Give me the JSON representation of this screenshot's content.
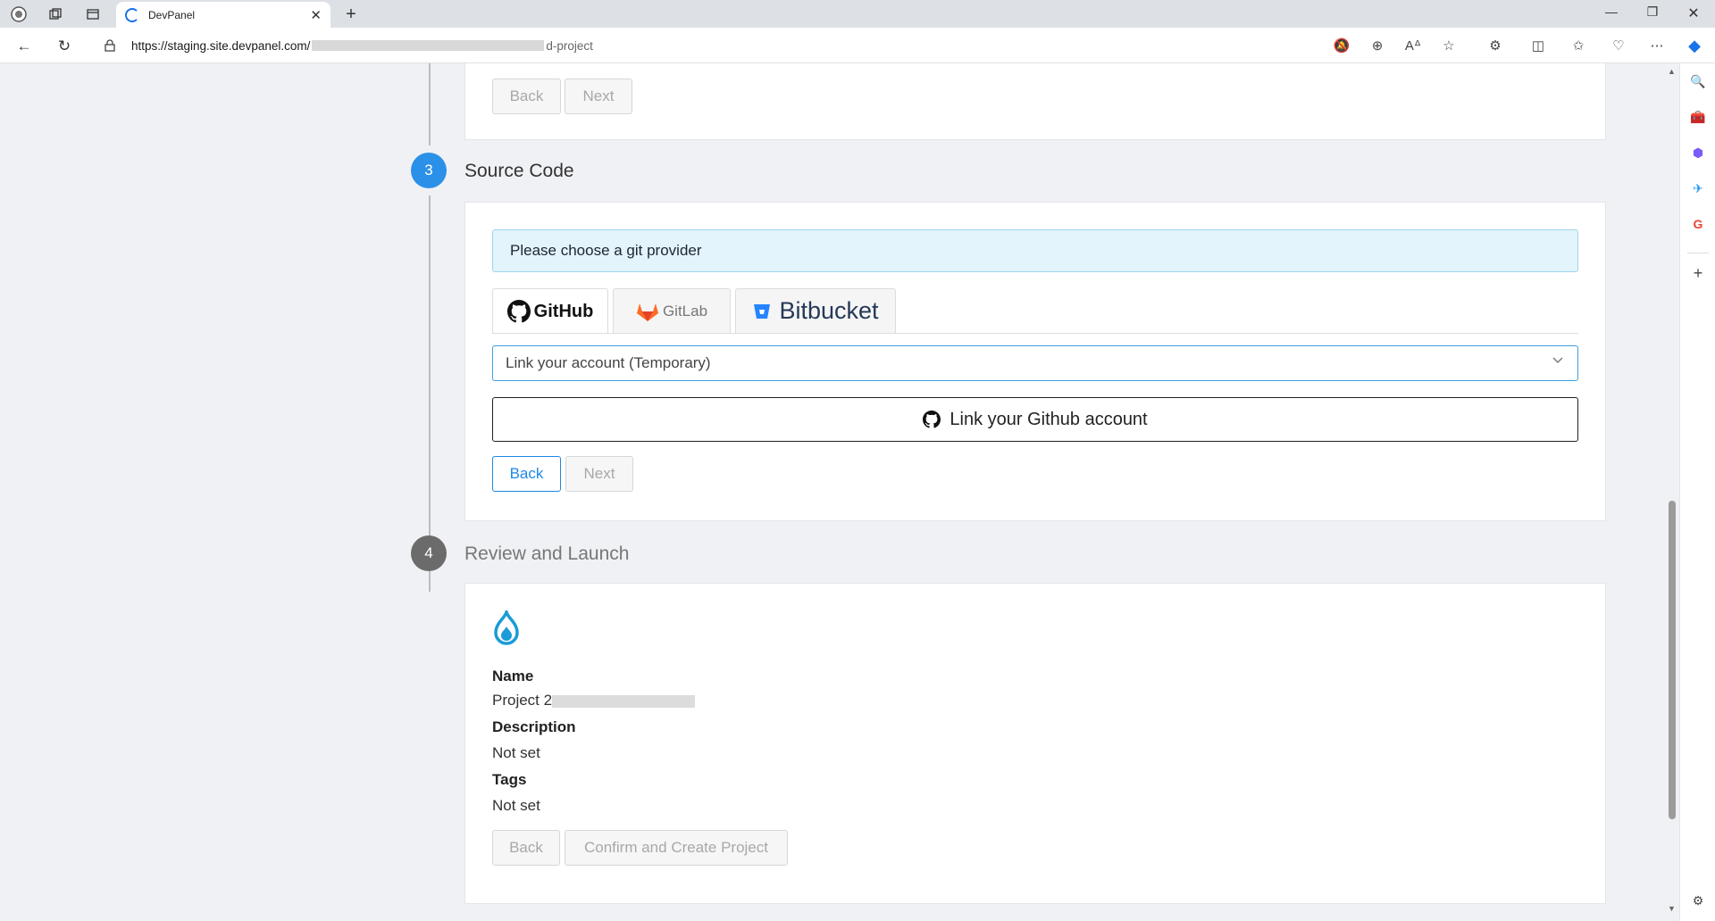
{
  "browser": {
    "tab_title": "DevPanel",
    "url_host": "https://staging.site.devpanel.com/",
    "url_tail": "d-project"
  },
  "step_prev": {
    "back_label": "Back",
    "next_label": "Next"
  },
  "step3": {
    "number": "3",
    "title": "Source Code",
    "alert": "Please choose a git provider",
    "providers": [
      "GitHub",
      "GitLab",
      "Bitbucket"
    ],
    "account_select": "Link your account (Temporary)",
    "link_button": "Link your Github account",
    "back_label": "Back",
    "next_label": "Next"
  },
  "step4": {
    "number": "4",
    "title": "Review and Launch",
    "name_label": "Name",
    "name_value": "Project 2",
    "description_label": "Description",
    "description_value": "Not set",
    "tags_label": "Tags",
    "tags_value": "Not set",
    "back_label": "Back",
    "confirm_label": "Confirm and Create Project"
  },
  "colors": {
    "accent": "#1e88e5",
    "step_active": "#2b90e8",
    "step_inactive": "#6b6b6b",
    "drupal": "#1b9bd7"
  }
}
